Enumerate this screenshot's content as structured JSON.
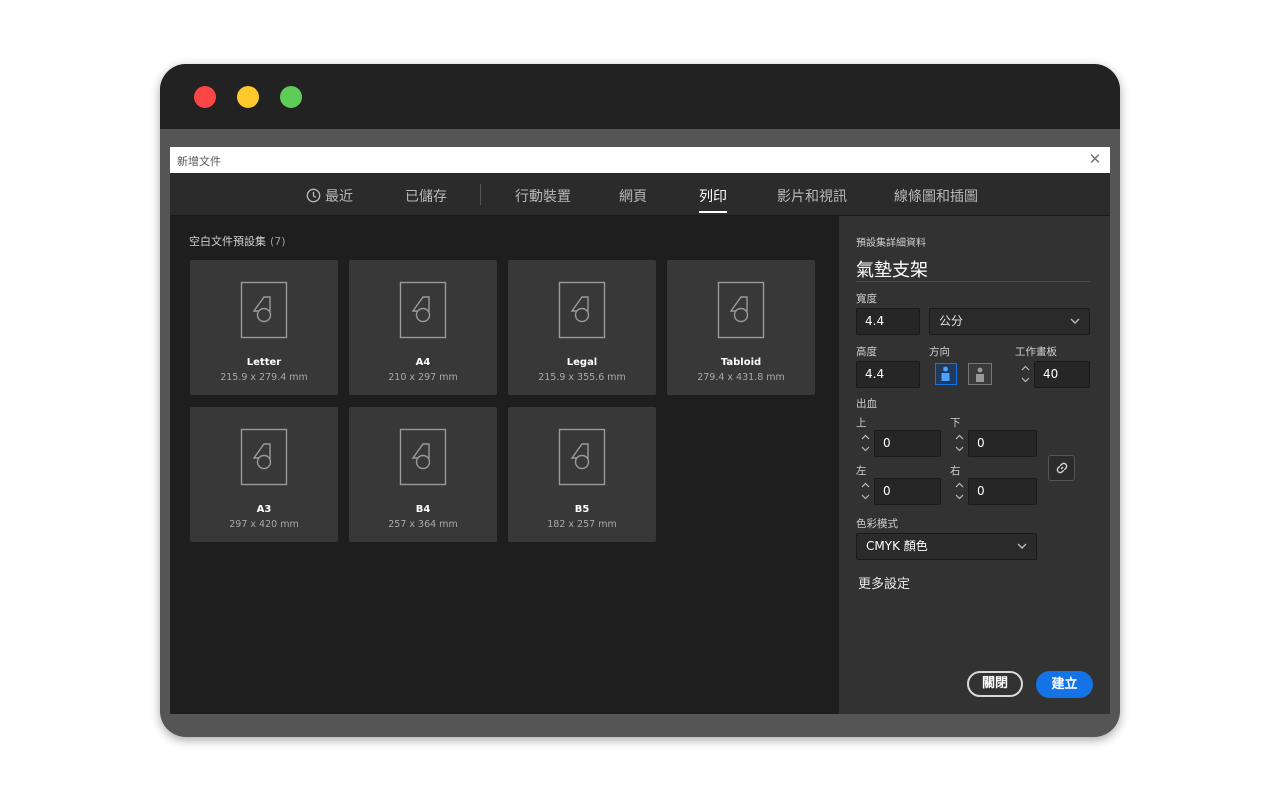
{
  "window": {
    "title": "新增文件"
  },
  "tabs": [
    {
      "label": "最近",
      "icon": "clock-icon"
    },
    {
      "label": "已儲存"
    },
    {
      "label": "行動裝置"
    },
    {
      "label": "網頁"
    },
    {
      "label": "列印",
      "active": true
    },
    {
      "label": "影片和視訊"
    },
    {
      "label": "線條圖和插圖"
    }
  ],
  "presets": {
    "heading": "空白文件預設集",
    "count": "(7)",
    "items": [
      {
        "name": "Letter",
        "size": "215.9 x 279.4 mm"
      },
      {
        "name": "A4",
        "size": "210 x 297 mm"
      },
      {
        "name": "Legal",
        "size": "215.9 x 355.6 mm"
      },
      {
        "name": "Tabloid",
        "size": "279.4 x 431.8 mm"
      },
      {
        "name": "A3",
        "size": "297 x 420 mm"
      },
      {
        "name": "B4",
        "size": "257 x 364 mm"
      },
      {
        "name": "B5",
        "size": "182 x 257 mm"
      }
    ]
  },
  "details": {
    "section_label": "預設集詳細資料",
    "preset_name": "氣墊支架",
    "width_label": "寬度",
    "width_value": "4.4",
    "unit_value": "公分",
    "height_label": "高度",
    "height_value": "4.4",
    "orientation_label": "方向",
    "artboards_label": "工作畫板",
    "artboards_value": "40",
    "bleed_label": "出血",
    "top_label": "上",
    "top_value": "0",
    "bottom_label": "下",
    "bottom_value": "0",
    "left_label": "左",
    "left_value": "0",
    "right_label": "右",
    "right_value": "0",
    "color_mode_label": "色彩模式",
    "color_mode_value": "CMYK 顏色",
    "more_settings": "更多設定",
    "close_button": "關閉",
    "create_button": "建立"
  },
  "colors": {
    "accent": "#1473e6",
    "dialog_bg": "#1e1e1e",
    "panel_bg": "#323232",
    "card_bg": "#383838",
    "mac_close": "#fc4646",
    "mac_minimize": "#fec92b",
    "mac_zoom": "#5ecc56"
  }
}
